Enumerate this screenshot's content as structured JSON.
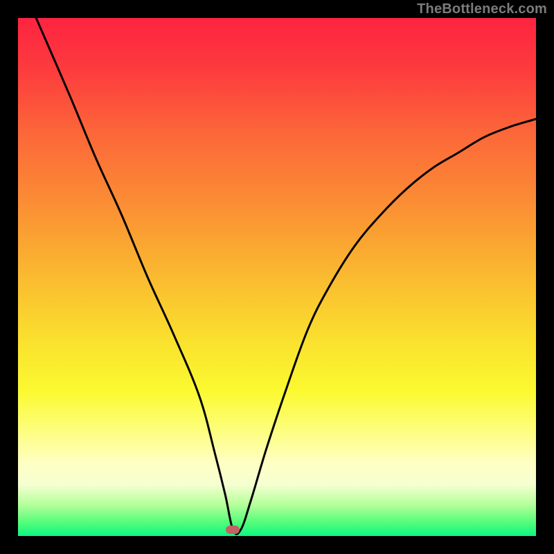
{
  "watermark": "TheBottleneck.com",
  "colors": {
    "background": "#000000",
    "curve": "#000000",
    "marker": "#c36164",
    "watermark": "#7c7c7c"
  },
  "chart_data": {
    "type": "line",
    "title": "",
    "xlabel": "",
    "ylabel": "",
    "x_range": [
      0,
      100
    ],
    "y_range": [
      0,
      100
    ],
    "series": [
      {
        "name": "bottleneck-curve",
        "x": [
          3.5,
          10,
          15,
          20,
          25,
          30,
          35,
          38,
          40,
          41.5,
          43,
          45,
          48,
          52,
          56,
          60,
          65,
          70,
          75,
          80,
          85,
          90,
          95,
          100
        ],
        "values": [
          100,
          85,
          73,
          62,
          50,
          39,
          27,
          16,
          8,
          1.2,
          1.2,
          7,
          17,
          29,
          40,
          48,
          56,
          62,
          67,
          71,
          74,
          77,
          79,
          80.5
        ]
      }
    ],
    "marker": {
      "x": 41.5,
      "y": 1.2
    },
    "gradient_stops": [
      {
        "pct": 0,
        "color": "#fd2440"
      },
      {
        "pct": 10,
        "color": "#fd3b3e"
      },
      {
        "pct": 22,
        "color": "#fc6639"
      },
      {
        "pct": 35,
        "color": "#fb8b34"
      },
      {
        "pct": 48,
        "color": "#fab430"
      },
      {
        "pct": 62,
        "color": "#fae02e"
      },
      {
        "pct": 72,
        "color": "#fbf930"
      },
      {
        "pct": 79,
        "color": "#fdfe77"
      },
      {
        "pct": 86,
        "color": "#feffc4"
      },
      {
        "pct": 90,
        "color": "#f6ffd2"
      },
      {
        "pct": 94,
        "color": "#b4ff9a"
      },
      {
        "pct": 97.5,
        "color": "#50fd7a"
      },
      {
        "pct": 100,
        "color": "#0cf782"
      }
    ]
  }
}
